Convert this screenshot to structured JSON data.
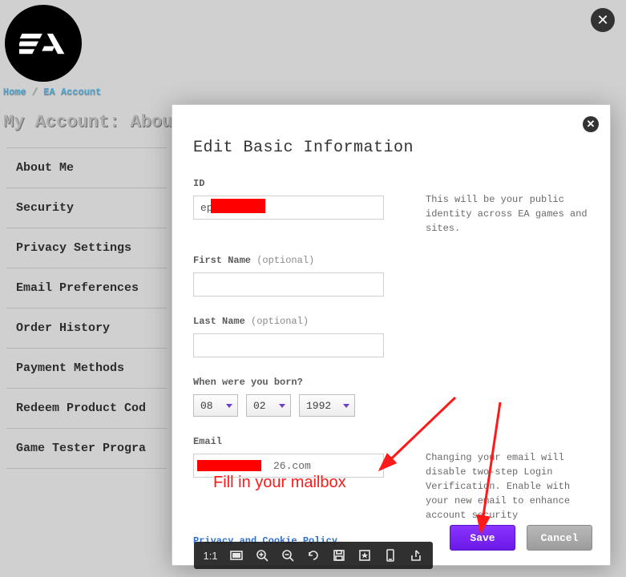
{
  "breadcrumb": {
    "home": "Home",
    "sep": " / ",
    "section": "EA Account"
  },
  "page_title": "My Account: About M",
  "sidebar": {
    "items": [
      {
        "label": "About Me"
      },
      {
        "label": "Security"
      },
      {
        "label": "Privacy Settings"
      },
      {
        "label": "Email Preferences"
      },
      {
        "label": "Order History"
      },
      {
        "label": "Payment Methods"
      },
      {
        "label": "Redeem Product Cod"
      },
      {
        "label": "Game Tester Progra"
      }
    ]
  },
  "modal": {
    "title": "Edit Basic Information",
    "id_label": "ID",
    "id_value": "ep",
    "id_help": "This will be your public identity across EA games and sites.",
    "first_name_label": "First Name",
    "last_name_label": "Last Name",
    "optional": "(optional)",
    "dob_label": "When were you born?",
    "dob": {
      "month": "08",
      "day": "02",
      "year": "1992"
    },
    "email_label": "Email",
    "email_visible": "26.com",
    "email_help": "Changing your email will disable two-step Login Verification. Enable with your new email to enhance account security",
    "policy_link": "Privacy and Cookie Policy",
    "save": "Save",
    "cancel": "Cancel"
  },
  "annotation": {
    "text": "Fill in your mailbox"
  },
  "viewer": {
    "zoom": "1:1"
  }
}
